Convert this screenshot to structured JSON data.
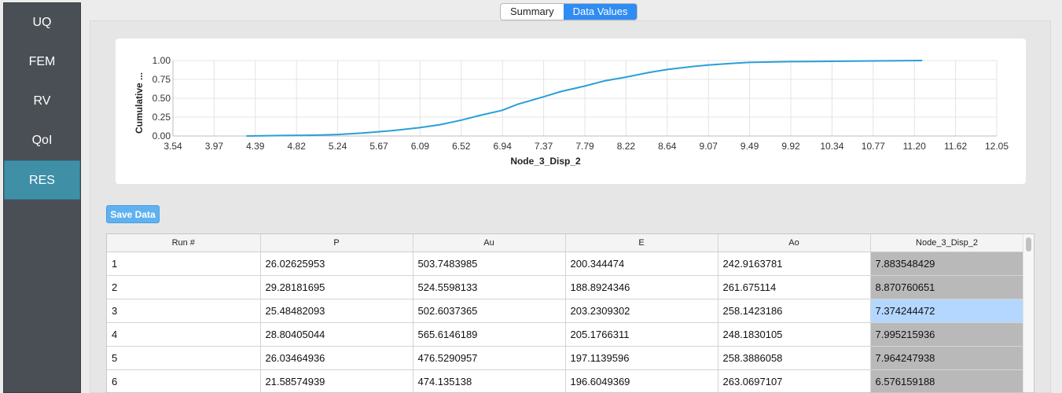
{
  "sidebar": {
    "items": [
      {
        "label": "UQ",
        "active": false
      },
      {
        "label": "FEM",
        "active": false
      },
      {
        "label": "RV",
        "active": false
      },
      {
        "label": "QoI",
        "active": false
      },
      {
        "label": "RES",
        "active": true
      }
    ]
  },
  "tabs": [
    {
      "label": "Summary",
      "active": false
    },
    {
      "label": "Data Values",
      "active": true
    }
  ],
  "save_button": {
    "label": "Save Data"
  },
  "colors": {
    "accent": "#2f8cf3",
    "sidebar_active": "#3f8fa7",
    "series": "#2a9fd8"
  },
  "chart_data": {
    "type": "line",
    "xlabel": "Node_3_Disp_2",
    "ylabel": "Cumulative ...",
    "xlim": [
      3.54,
      12.05
    ],
    "ylim": [
      0,
      1
    ],
    "x_ticks": [
      "3.54",
      "3.97",
      "4.39",
      "4.82",
      "5.24",
      "5.67",
      "6.09",
      "6.52",
      "6.94",
      "7.37",
      "7.79",
      "8.22",
      "8.64",
      "9.07",
      "9.49",
      "9.92",
      "10.34",
      "10.77",
      "11.20",
      "11.62",
      "12.05"
    ],
    "y_ticks": [
      "0.00",
      "0.25",
      "0.50",
      "0.75",
      "1.00"
    ],
    "grid": true,
    "series": [
      {
        "x": [
          4.3,
          4.6,
          5.0,
          5.24,
          5.5,
          5.8,
          6.09,
          6.3,
          6.52,
          6.7,
          6.94,
          7.1,
          7.37,
          7.55,
          7.79,
          8.0,
          8.22,
          8.45,
          8.64,
          8.9,
          9.07,
          9.3,
          9.49,
          9.92,
          10.34,
          10.77,
          11.28
        ],
        "y": [
          0.0,
          0.005,
          0.01,
          0.02,
          0.04,
          0.07,
          0.11,
          0.15,
          0.21,
          0.27,
          0.34,
          0.42,
          0.52,
          0.59,
          0.66,
          0.73,
          0.78,
          0.84,
          0.88,
          0.92,
          0.94,
          0.96,
          0.975,
          0.985,
          0.99,
          0.995,
          1.0
        ]
      }
    ]
  },
  "table": {
    "columns": [
      "Run #",
      "P",
      "Au",
      "E",
      "Ao",
      "Node_3_Disp_2"
    ],
    "rows": [
      [
        "1",
        "26.02625953",
        "503.7483985",
        "200.344474",
        "242.9163781",
        "7.883548429"
      ],
      [
        "2",
        "29.28181695",
        "524.5598133",
        "188.8924346",
        "261.675114",
        "8.870760651"
      ],
      [
        "3",
        "25.48482093",
        "502.6037365",
        "203.2309302",
        "258.1423186",
        "7.374244472"
      ],
      [
        "4",
        "28.80405044",
        "565.6146189",
        "205.1766311",
        "248.1830105",
        "7.995215936"
      ],
      [
        "5",
        "26.03464936",
        "476.5290957",
        "197.1139596",
        "258.3886058",
        "7.964247938"
      ],
      [
        "6",
        "21.58574939",
        "474.135138",
        "196.6049369",
        "263.0697107",
        "6.576159188"
      ]
    ]
  }
}
